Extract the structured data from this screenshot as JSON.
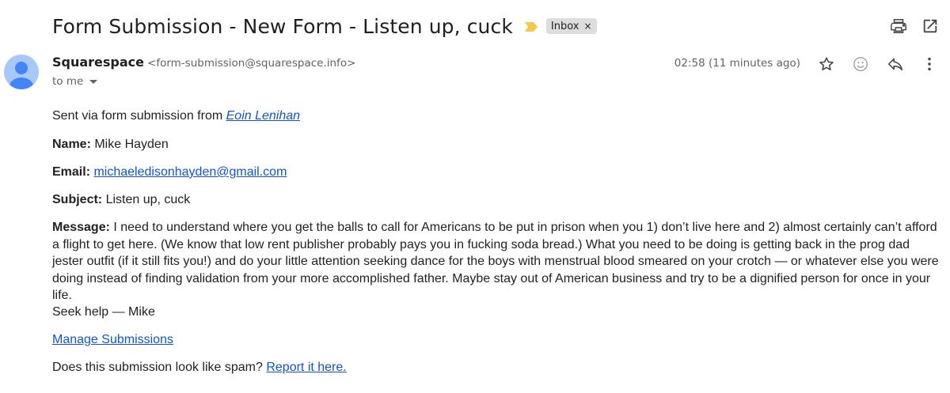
{
  "header": {
    "subject": "Form Submission - New Form - Listen up, cuck",
    "label": "Inbox",
    "label_remove": "×"
  },
  "colors": {
    "importance_marker": "#f2c94c",
    "link": "#1155cc",
    "avatar_bg": "#a8c7fa",
    "avatar_fg": "#4285f4"
  },
  "icons": {
    "print": "print-icon",
    "popout": "open-in-new-window-icon",
    "star": "star-icon",
    "emoji": "emoji-reaction-icon",
    "reply": "reply-icon",
    "more": "more-vert-icon"
  },
  "sender": {
    "name": "Squarespace",
    "email": "<form-submission@squarespace.info>",
    "to": "to me",
    "timestamp": "02:58 (11 minutes ago)"
  },
  "body": {
    "intro": "Sent via form submission from ",
    "intro_link": "Eoin Lenihan",
    "name_label": "Name:",
    "name_value": " Mike Hayden",
    "email_label": "Email:",
    "email_value": "michaeledisonhayden@gmail.com",
    "subject_label": "Subject:",
    "subject_value": " Listen up, cuck",
    "message_label": "Message:",
    "message_value": " I need to understand where you get the balls to call for Americans to be put in prison when you 1) don’t live here and 2) almost certainly can’t afford a flight to get here. (We know that low rent publisher probably pays you in fucking soda bread.) What you need to be doing is getting back in the prog dad jester outfit (if it still fits you!) and do your little attention seeking dance for the boys with menstrual blood smeared on your crotch — or whatever else you were doing instead of finding validation from your more accomplished father. Maybe stay out of American business and try to be a dignified person for once in your life.",
    "signoff": "Seek help — Mike",
    "manage_link": "Manage Submissions",
    "spam_question": "Does this submission look like spam? ",
    "spam_link": "Report it here."
  }
}
